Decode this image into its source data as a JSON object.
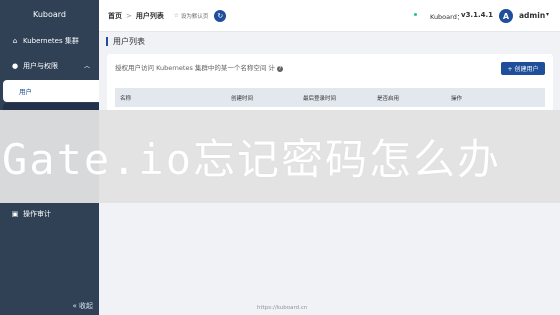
{
  "sidebar": {
    "logo": "Kuboard",
    "items": [
      {
        "label": "Kubernetes 集群",
        "icon": "home-icon"
      },
      {
        "label": "用户与权限",
        "icon": "user-icon"
      },
      {
        "label": "用户"
      }
    ],
    "audit_label": "操作审计",
    "audit_icon": "audit-icon",
    "collapse_label": "« 收起"
  },
  "header": {
    "breadcrumb_home": "首页",
    "breadcrumb_sep": ">",
    "breadcrumb_current": "用户列表",
    "default_note": "设为默认页",
    "version_label": "Kuboard：",
    "version": "v3.1.4.1",
    "avatar_letter": "A",
    "username": "admin"
  },
  "main": {
    "page_title": "用户列表",
    "description": "授权用户访问 Kubernetes 集群中的某一个名称空间 计",
    "create_button": "+ 创建用户",
    "table_headers": [
      "名称",
      "创建时间",
      "最后登录时间",
      "是否启用",
      "操作"
    ]
  },
  "banner_text": "Gate.io忘记密码怎么办",
  "footer": "https://kuboard.cn",
  "colors": {
    "sidebar": "#304156",
    "accent": "#1f4e9a",
    "status_dot": "#27c19b"
  }
}
